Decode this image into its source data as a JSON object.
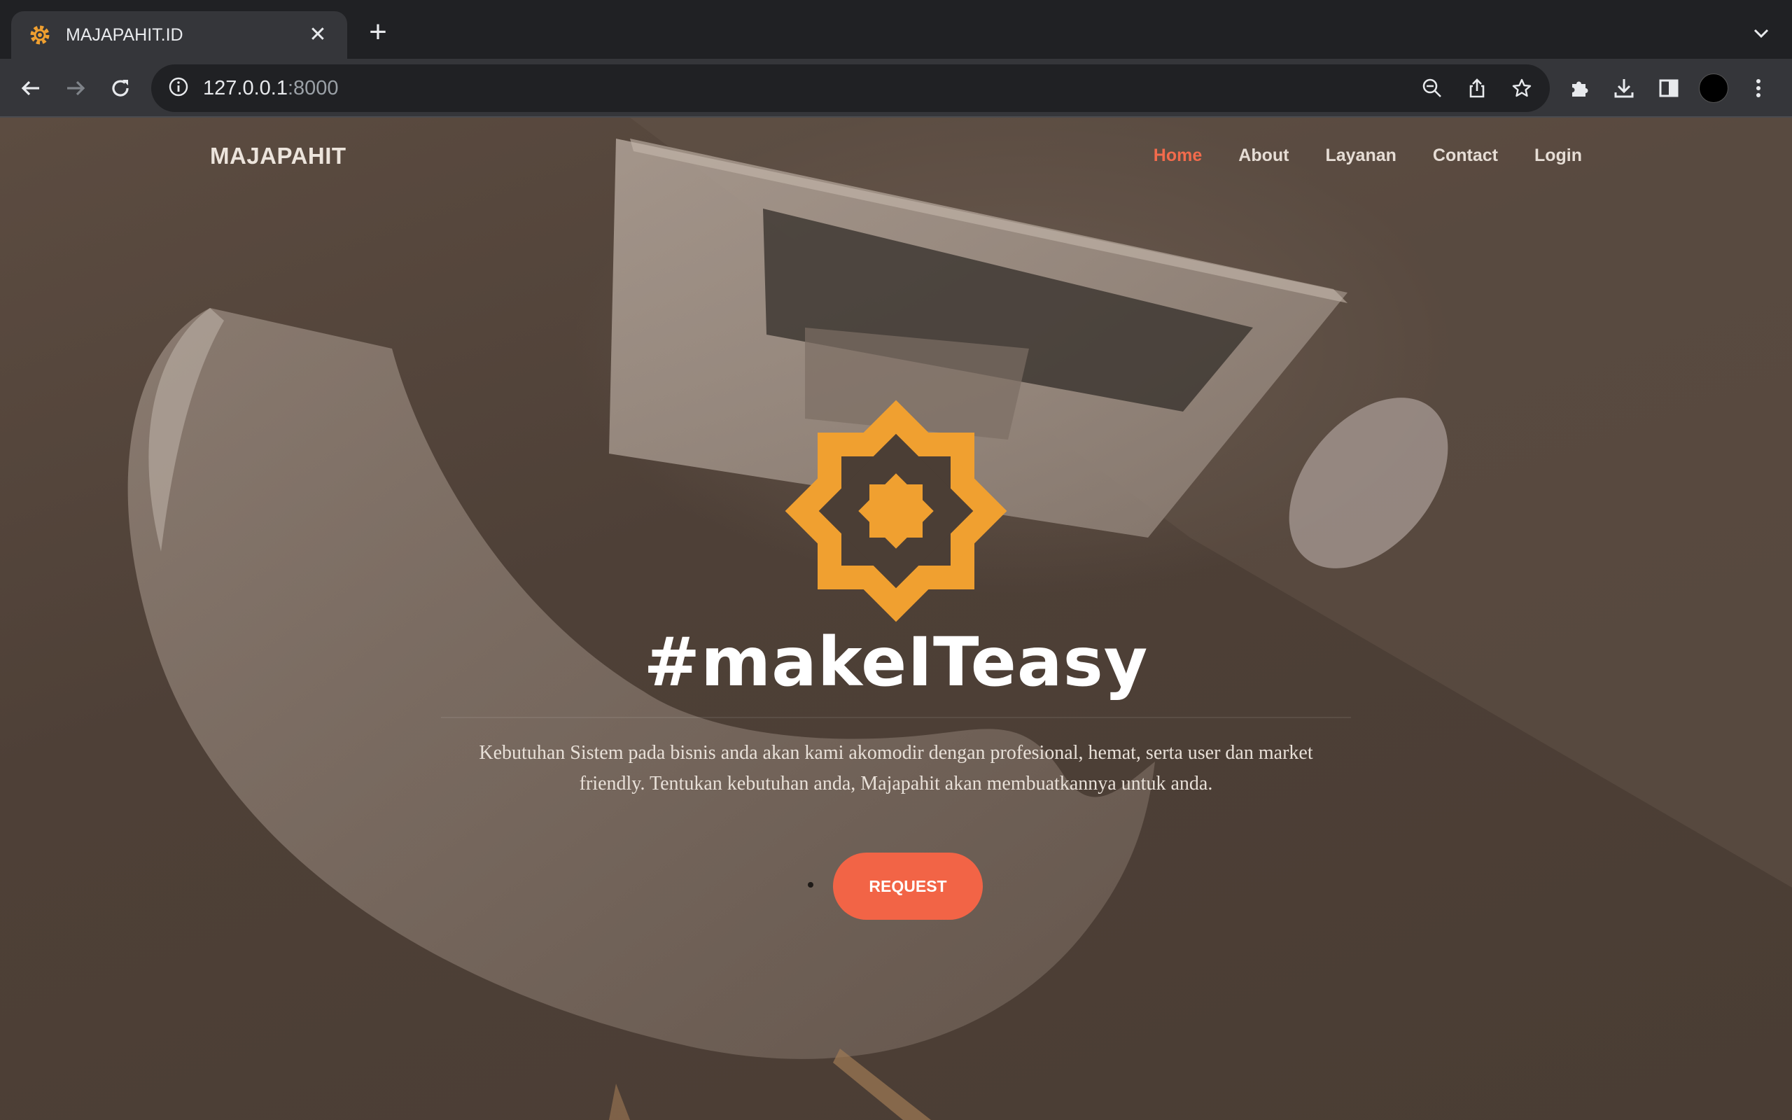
{
  "browser": {
    "tab": {
      "title": "MAJAPAHIT.ID",
      "close_label": "✕",
      "favicon": "gear-icon"
    },
    "new_tab_label": "+",
    "url_host": "127.0.0.1",
    "url_port": ":8000",
    "icons": [
      "back-icon",
      "forward-icon",
      "reload-icon",
      "info-icon",
      "zoom-out-icon",
      "share-icon",
      "star-icon",
      "extensions-icon",
      "download-icon",
      "side-panel-icon",
      "profile-avatar",
      "menu-icon",
      "tab-list-icon"
    ]
  },
  "site": {
    "brand": "MAJAPAHIT",
    "nav": [
      {
        "label": "Home",
        "active": true
      },
      {
        "label": "About",
        "active": false
      },
      {
        "label": "Layanan",
        "active": false
      },
      {
        "label": "Contact",
        "active": false
      },
      {
        "label": "Login",
        "active": false
      }
    ],
    "hero": {
      "title": "#makeITeasy",
      "text": "Kebutuhan Sistem pada bisnis anda akan kami akomodir dengan profesional, hemat, serta user dan market friendly. Tentukan kebutuhan anda, Majapahit akan membuatkannya untuk anda.",
      "button": "REQUEST"
    }
  },
  "colors": {
    "accent": "#f26446",
    "nav_active": "#f26b4c",
    "logo": "#f0a030"
  }
}
